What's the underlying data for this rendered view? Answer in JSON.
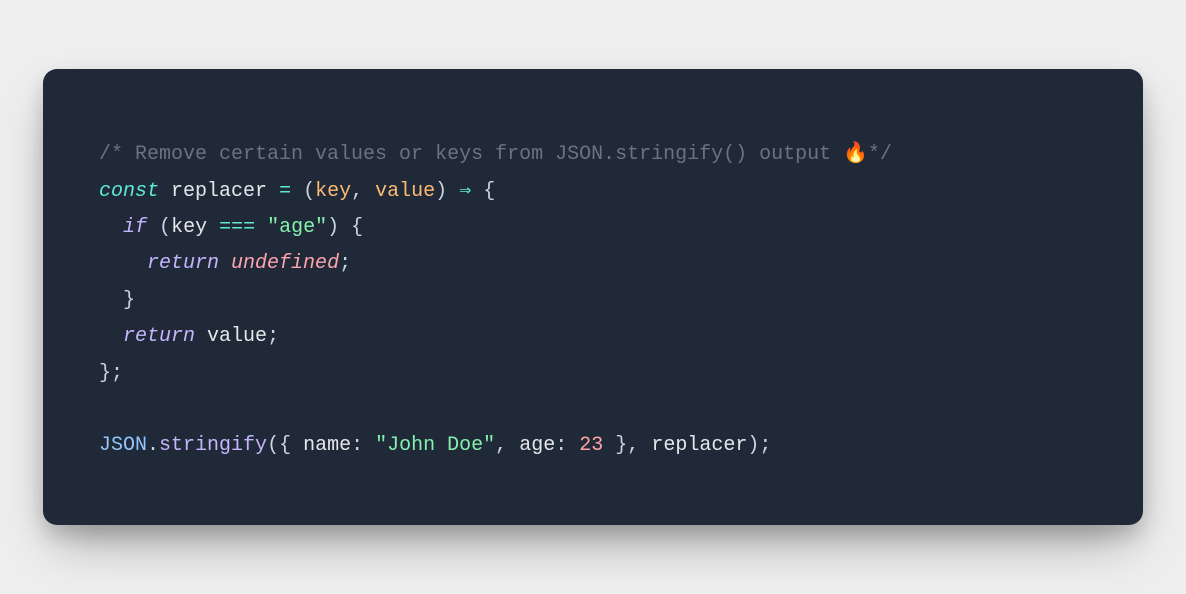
{
  "snippet": {
    "comment_open": "/* ",
    "comment_text": "Remove certain values or keys from JSON.stringify() output ",
    "comment_emoji": "🔥",
    "comment_close": "*/",
    "kw_const": "const",
    "id_replacer": "replacer",
    "op_assign": "=",
    "paren_open": "(",
    "param_key": "key",
    "comma": ",",
    "param_value": "value",
    "paren_close": ")",
    "arrow": "⇒",
    "brace_open": "{",
    "kw_if": "if",
    "op_eq": "===",
    "str_age": "\"age\"",
    "kw_return": "return",
    "kw_undefined": "undefined",
    "semicolon": ";",
    "brace_close": "}",
    "id_value": "value",
    "id_JSON": "JSON",
    "dot": ".",
    "fn_stringify": "stringify",
    "obj_open": "{ ",
    "prop_name": "name",
    "colon": ":",
    "str_john": "\"John Doe\"",
    "prop_age": "age",
    "num_23": "23",
    "obj_close": " }"
  }
}
